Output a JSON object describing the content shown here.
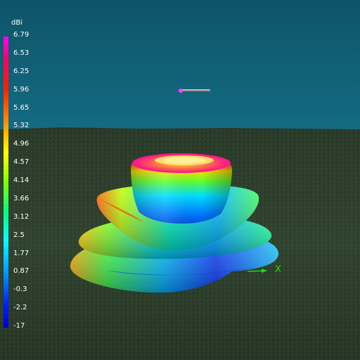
{
  "legend": {
    "unit": "dBi",
    "ticks": [
      "6.79",
      "6.53",
      "6.25",
      "5.96",
      "5.65",
      "5.32",
      "4.96",
      "4.57",
      "4.14",
      "3.66",
      "3.12",
      "2.5",
      "1.77",
      "0.87",
      "-0.3",
      "-2.2",
      "-17"
    ]
  },
  "axis": {
    "x_label": "X"
  },
  "colors": {
    "sky": "#0f5a70",
    "ground": "#2f4030",
    "axis_x": "#18e018",
    "antenna_feed": "#ff40ff"
  }
}
